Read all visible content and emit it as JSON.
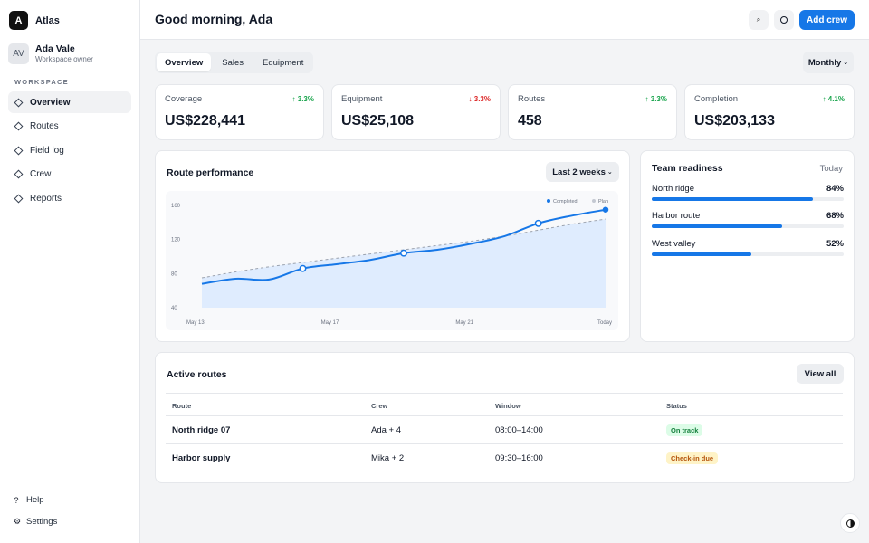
{
  "brand": {
    "logo_letter": "A",
    "name": "Atlas"
  },
  "user": {
    "initials": "AV",
    "name": "Ada Vale",
    "role": "Workspace owner"
  },
  "sidebar": {
    "section_label": "WORKSPACE",
    "items": [
      {
        "label": "Overview",
        "active": true
      },
      {
        "label": "Routes"
      },
      {
        "label": "Field log"
      },
      {
        "label": "Crew"
      },
      {
        "label": "Reports"
      }
    ],
    "help_label": "Help",
    "settings_label": "Settings"
  },
  "header": {
    "greeting": "Good morning, Ada",
    "search_icon_glyph": "⌕",
    "add_button": "Add crew"
  },
  "tabs": [
    "Overview",
    "Sales",
    "Equipment"
  ],
  "period_select": "Monthly",
  "kpis": [
    {
      "label": "Coverage",
      "value": "US$228,441",
      "delta": "↑ 3.3%",
      "direction": "up"
    },
    {
      "label": "Equipment",
      "value": "US$25,108",
      "delta": "↓ 3.3%",
      "direction": "down"
    },
    {
      "label": "Routes",
      "value": "458",
      "delta": "↑ 3.3%",
      "direction": "up"
    },
    {
      "label": "Completion",
      "value": "US$203,133",
      "delta": "↑ 4.1%",
      "direction": "up"
    }
  ],
  "route_performance": {
    "title": "Route performance",
    "range_select": "Last 2 weeks"
  },
  "chart_data": {
    "type": "area",
    "x": [
      "May 13",
      "May 14",
      "May 15",
      "May 16",
      "May 17",
      "May 18",
      "May 19",
      "May 20",
      "May 21",
      "May 22",
      "May 23",
      "May 24",
      "Today"
    ],
    "x_tick_labels": [
      "May 13",
      "May 17",
      "May 21",
      "Today"
    ],
    "y_tick_labels": [
      "160",
      "120",
      "80",
      "40"
    ],
    "ylim": [
      40,
      160
    ],
    "legend": [
      "Completed",
      "Plan"
    ],
    "legend_position": "top-right",
    "grid": false,
    "series": [
      {
        "name": "Completed",
        "values": [
          68,
          74,
          73,
          86,
          91,
          96,
          104,
          108,
          115,
          124,
          139,
          148,
          155
        ],
        "highlight_points": [
          3,
          6,
          10,
          12
        ]
      },
      {
        "name": "Plan",
        "values": [
          75,
          82,
          88,
          93,
          98,
          103,
          108,
          113,
          118,
          124,
          131,
          138,
          144
        ]
      }
    ],
    "colors": {
      "completed": "#1677e7",
      "plan": "#9ca3af",
      "fill": "#dbeafe"
    }
  },
  "team_readiness": {
    "title": "Team readiness",
    "subtitle": "Today",
    "items": [
      {
        "name": "North ridge",
        "percent_text": "84%",
        "value": 0.84
      },
      {
        "name": "Harbor route",
        "percent_text": "68%",
        "value": 0.68
      },
      {
        "name": "West valley",
        "percent_text": "52%",
        "value": 0.52
      }
    ]
  },
  "active_routes": {
    "title": "Active routes",
    "view_all": "View all",
    "columns": [
      "Route",
      "Crew",
      "Window",
      "Status"
    ],
    "rows": [
      {
        "route": "North ridge 07",
        "crew": "Ada + 4",
        "window": "08:00–14:00",
        "status": "On track",
        "status_tone": "success"
      },
      {
        "route": "Harbor supply",
        "crew": "Mika + 2",
        "window": "09:30–16:00",
        "status": "Check-in due",
        "status_tone": "warning"
      }
    ]
  },
  "colors": {
    "accent": "#1677e7",
    "success": "#16a34a",
    "danger": "#dc2626",
    "warning_text": "#b45309"
  }
}
